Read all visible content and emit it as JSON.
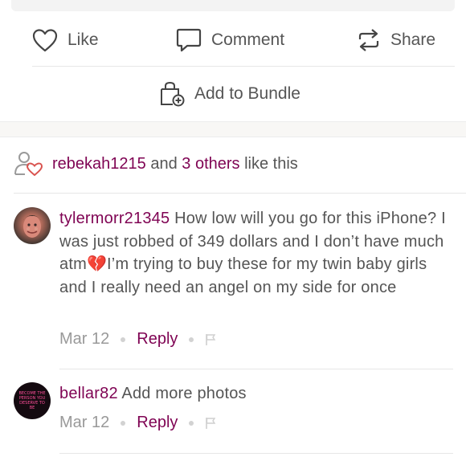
{
  "actions": {
    "like_label": "Like",
    "comment_label": "Comment",
    "share_label": "Share",
    "bundle_label": "Add to Bundle"
  },
  "likes": {
    "user": "rebekah1215",
    "and": "and",
    "others": "3 others",
    "suffix": "like this"
  },
  "comments": [
    {
      "username": "tylermorr21345",
      "text": "How low will you go for this iPhone? I was just robbed of 349 dollars and I don’t have much atm💔I’m trying to buy these for my twin baby girls and I really need an angel on my side for once",
      "date": "Mar 12",
      "reply": "Reply"
    },
    {
      "username": "bellar82",
      "text": "Add more photos",
      "date": "Mar 12",
      "reply": "Reply",
      "avatar_text": "BECOME THE PERSON YOU DESERVE TO BE"
    }
  ],
  "colors": {
    "accent": "#7f0353",
    "text": "#555555",
    "muted": "#999999",
    "heart": "#d9534f"
  }
}
